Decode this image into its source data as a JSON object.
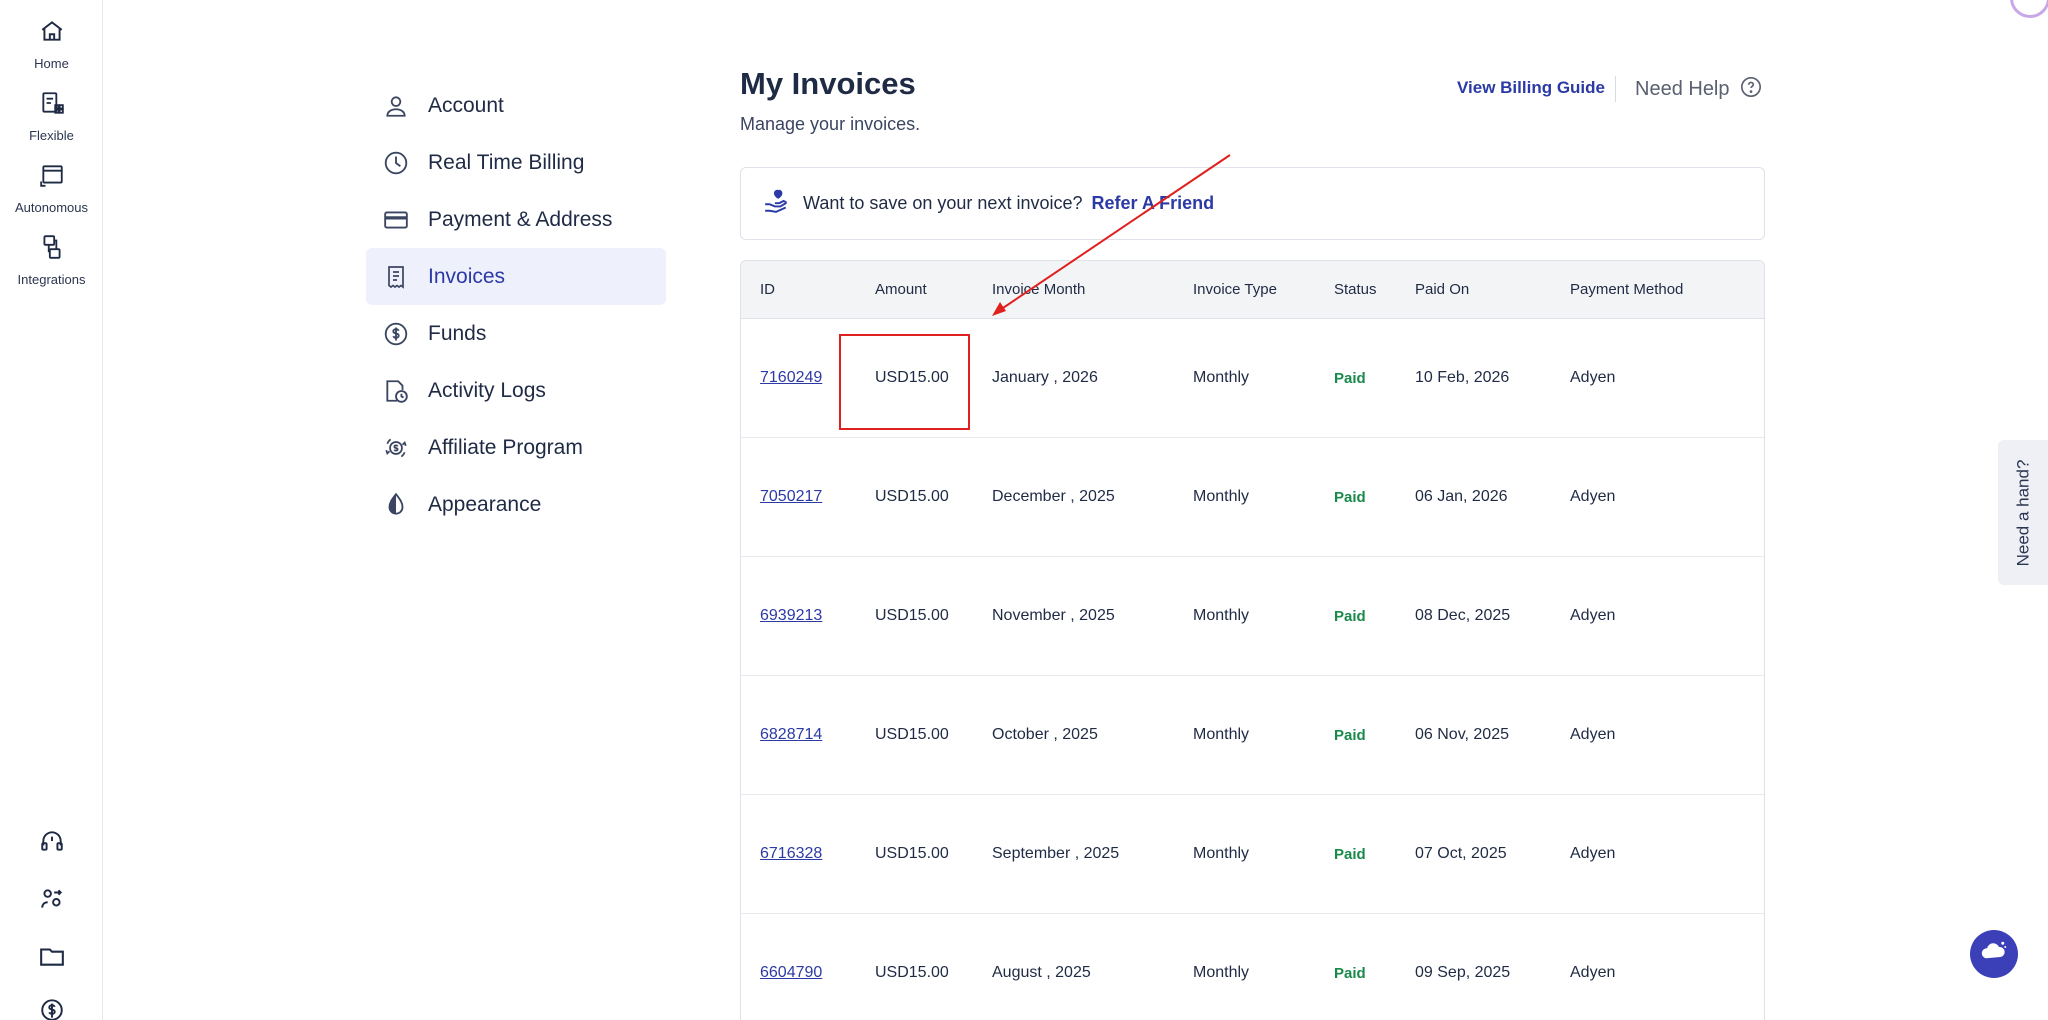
{
  "rail": {
    "items": [
      {
        "label": "Home",
        "icon": "home-icon"
      },
      {
        "label": "Flexible",
        "icon": "flexible-icon"
      },
      {
        "label": "Autonomous",
        "icon": "autonomous-icon"
      },
      {
        "label": "Integrations",
        "icon": "integrations-icon"
      }
    ],
    "bottom_icons": [
      "support-icon",
      "user-switch-icon",
      "folder-icon",
      "billing-icon"
    ]
  },
  "nav": {
    "items": [
      {
        "label": "Account",
        "icon": "user-icon"
      },
      {
        "label": "Real Time Billing",
        "icon": "clock-icon"
      },
      {
        "label": "Payment & Address",
        "icon": "credit-card-icon"
      },
      {
        "label": "Invoices",
        "icon": "invoice-icon",
        "active": true
      },
      {
        "label": "Funds",
        "icon": "dollar-icon"
      },
      {
        "label": "Activity Logs",
        "icon": "activity-log-icon"
      },
      {
        "label": "Affiliate Program",
        "icon": "affiliate-icon"
      },
      {
        "label": "Appearance",
        "icon": "appearance-icon"
      }
    ]
  },
  "header": {
    "title": "My Invoices",
    "subtitle": "Manage your invoices.",
    "guide_link": "View Billing Guide",
    "help_label": "Need Help"
  },
  "refer": {
    "text": "Want to save on your next invoice?",
    "link": "Refer A Friend"
  },
  "table": {
    "columns": [
      "ID",
      "Amount",
      "Invoice Month",
      "Invoice Type",
      "Status",
      "Paid On",
      "Payment Method"
    ],
    "rows": [
      {
        "id": "7160249",
        "amount": "USD15.00",
        "month": "January , 2026",
        "type": "Monthly",
        "status": "Paid",
        "paid_on": "10 Feb, 2026",
        "method": "Adyen"
      },
      {
        "id": "7050217",
        "amount": "USD15.00",
        "month": "December , 2025",
        "type": "Monthly",
        "status": "Paid",
        "paid_on": "06 Jan, 2026",
        "method": "Adyen"
      },
      {
        "id": "6939213",
        "amount": "USD15.00",
        "month": "November , 2025",
        "type": "Monthly",
        "status": "Paid",
        "paid_on": "08 Dec, 2025",
        "method": "Adyen"
      },
      {
        "id": "6828714",
        "amount": "USD15.00",
        "month": "October , 2025",
        "type": "Monthly",
        "status": "Paid",
        "paid_on": "06 Nov, 2025",
        "method": "Adyen"
      },
      {
        "id": "6716328",
        "amount": "USD15.00",
        "month": "September , 2025",
        "type": "Monthly",
        "status": "Paid",
        "paid_on": "07 Oct, 2025",
        "method": "Adyen"
      },
      {
        "id": "6604790",
        "amount": "USD15.00",
        "month": "August , 2025",
        "type": "Monthly",
        "status": "Paid",
        "paid_on": "09 Sep, 2025",
        "method": "Adyen"
      }
    ]
  },
  "side_tab": {
    "label": "Need a hand?"
  },
  "colors": {
    "accent": "#2c3aa6",
    "paid": "#1a8a4a",
    "annotation": "#e0201e"
  }
}
